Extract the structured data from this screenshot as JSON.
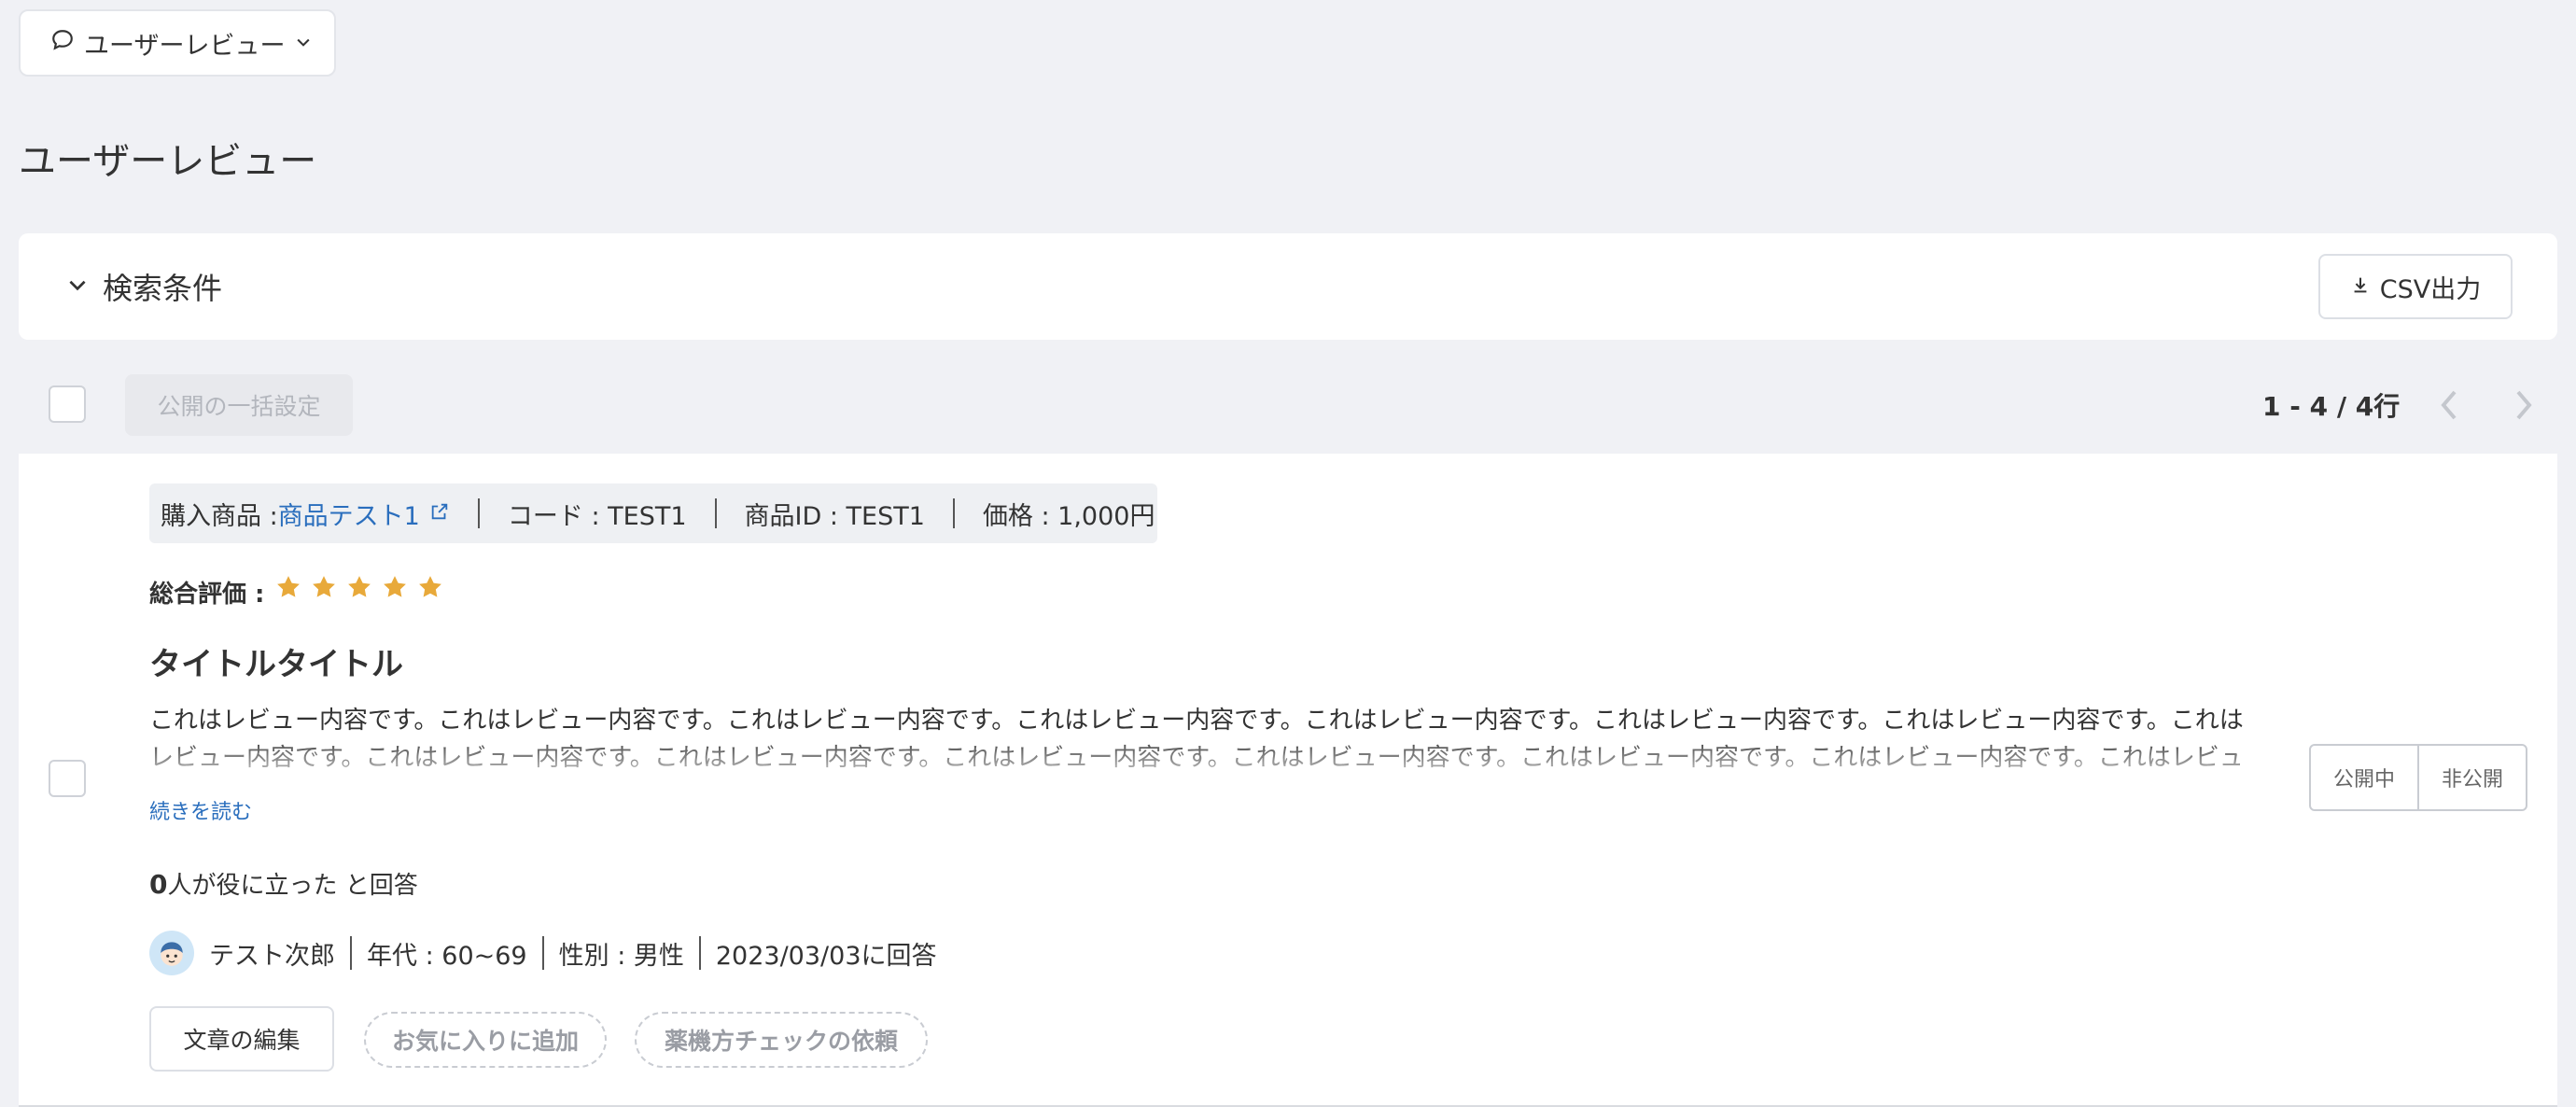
{
  "top_dropdown": {
    "label": "ユーザーレビュー"
  },
  "page_title": "ユーザーレビュー",
  "search_panel": {
    "toggle_label": "検索条件",
    "csv_label": "CSV出力"
  },
  "toolbar": {
    "bulk_label": "公開の一括設定",
    "pager_text": "1 - 4 / 4行"
  },
  "review": {
    "product": {
      "prefix": "購入商品 : ",
      "name": "商品テスト1",
      "code": "コード : TEST1",
      "product_id": "商品ID : TEST1",
      "price": "価格 : 1,000円"
    },
    "rating_label": "総合評価 :",
    "rating": 5,
    "rating_max": 5,
    "star_color": "#e8a93a",
    "title": "タイトルタイトル",
    "body": "これはレビュー内容です。これはレビュー内容です。これはレビュー内容です。これはレビュー内容です。これはレビュー内容です。これはレビュー内容です。これはレビュー内容です。これはレビュー内容です。これはレビュー内容です。これはレビュー内容です。これはレビュー内容です。これはレビュー内容です。これはレビュー内容です。これはレビュー内容です。これはレビュ",
    "read_more": "続きを読む",
    "helpful_count": "0",
    "helpful_text": "人が役に立った と回答",
    "user": {
      "name": "テスト次郎",
      "age": "年代 : 60~69",
      "gender": "性別 : 男性",
      "answered": "2023/03/03に回答",
      "avatar_icon": "boy-face-icon"
    },
    "actions": {
      "edit": "文章の編集",
      "favorite": "お気に入りに追加",
      "pharma_check": "薬機方チェックの依頼"
    },
    "publish": {
      "public": "公開中",
      "private": "非公開"
    }
  },
  "colors": {
    "link": "#2a6ebd",
    "background": "#f0f1f5"
  }
}
